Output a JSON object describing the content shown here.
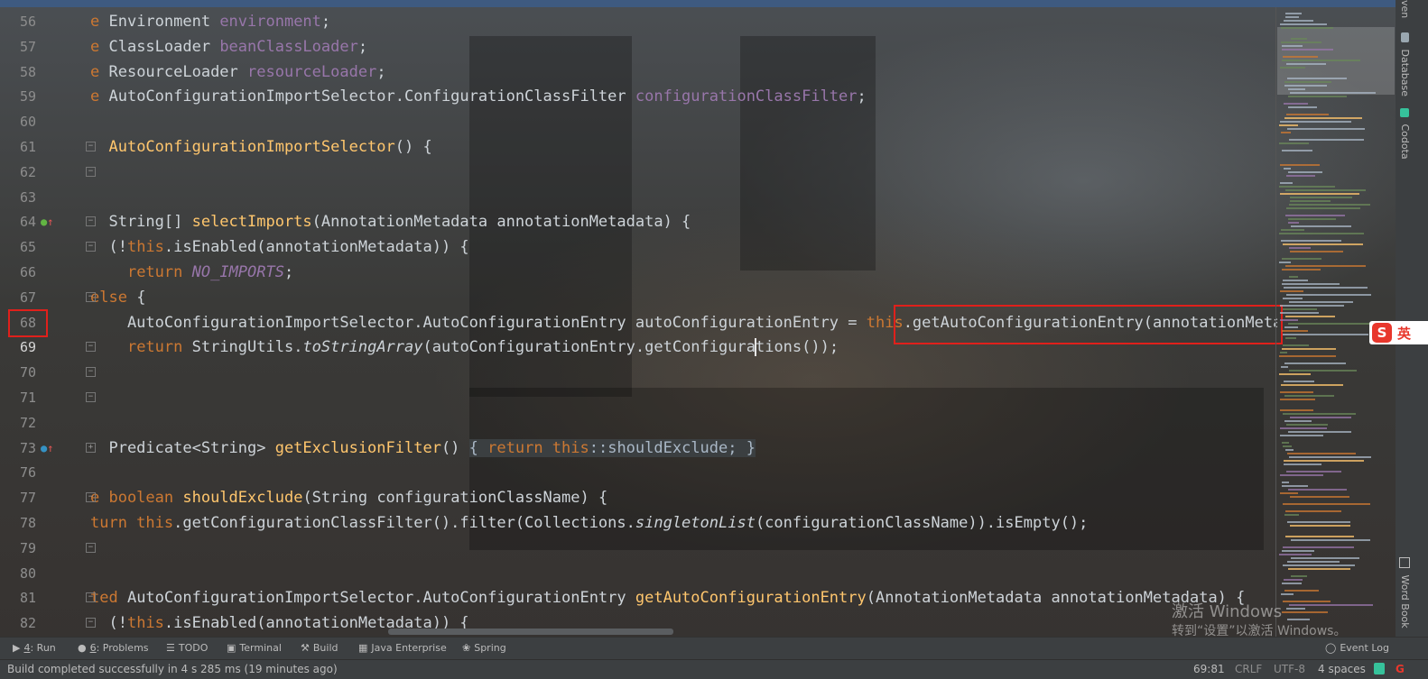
{
  "editor": {
    "lines": [
      {
        "num": "56",
        "html": "<span class=\"kw\">e</span> Environment <span class=\"fld\">environment</span>;"
      },
      {
        "num": "57",
        "html": "<span class=\"kw\">e</span> ClassLoader <span class=\"fld\">beanClassLoader</span>;"
      },
      {
        "num": "58",
        "html": "<span class=\"kw\">e</span> ResourceLoader <span class=\"fld\">resourceLoader</span>;"
      },
      {
        "num": "59",
        "html": "<span class=\"kw\">e</span> AutoConfigurationImportSelector.ConfigurationClassFilter <span class=\"fld\">configurationClassFilter</span>;"
      },
      {
        "num": "60",
        "html": ""
      },
      {
        "num": "61",
        "html": "  <span class=\"fn\">AutoConfigurationImportSelector</span>() {"
      },
      {
        "num": "62",
        "html": ""
      },
      {
        "num": "63",
        "html": ""
      },
      {
        "num": "64",
        "html": "  String[] <span class=\"fn\">selectImports</span>(AnnotationMetadata annotationMetadata) {"
      },
      {
        "num": "65",
        "html": "  (!<span class=\"kw\">this</span>.isEnabled(annotationMetadata)) {"
      },
      {
        "num": "66",
        "html": "    <span class=\"kw\">return</span> <span class=\"itf\">NO_IMPORTS</span>;"
      },
      {
        "num": "67",
        "html": "<span class=\"kw\">else</span> {"
      },
      {
        "num": "68",
        "html": "    AutoConfigurationImportSelector.AutoConfigurationEntry autoConfigurationEntry = <span class=\"kw\">this</span>.getAutoConfigurationEntry(annotationMetadata);"
      },
      {
        "num": "69",
        "html": "    <span class=\"kw\">return</span> StringUtils.<span class=\"it\">toStringArray</span>(autoConfigurationEntry.getConfigura<span class=\"caret\"></span>tions());"
      },
      {
        "num": "70",
        "html": ""
      },
      {
        "num": "71",
        "html": ""
      },
      {
        "num": "72",
        "html": ""
      },
      {
        "num": "73",
        "html": "  Predicate&lt;String&gt; <span class=\"fn\">getExclusionFilter</span>() <span class=\"fold-chip\">{ <span class=\"kw\">return this</span>::shouldExclude; }</span>"
      },
      {
        "num": "76",
        "html": ""
      },
      {
        "num": "77",
        "html": "<span class=\"kw\">e boolean</span> <span class=\"fn\">shouldExclude</span>(String configurationClassName) {"
      },
      {
        "num": "78",
        "html": "<span class=\"kw\">turn this</span>.getConfigurationClassFilter().filter(Collections.<span class=\"it\">singletonList</span>(configurationClassName)).isEmpty();"
      },
      {
        "num": "79",
        "html": ""
      },
      {
        "num": "80",
        "html": ""
      },
      {
        "num": "81",
        "html": "<span class=\"kw\">ted</span> AutoConfigurationImportSelector.AutoConfigurationEntry <span class=\"fn\">getAutoConfigurationEntry</span>(AnnotationMetadata annotationMetadata) {"
      },
      {
        "num": "82",
        "html": "  (!<span class=\"kw\">this</span>.isEnabled(annotationMetadata)) {"
      }
    ],
    "current_line": "69"
  },
  "right_panel": {
    "tabs": [
      "Database",
      "Codota",
      "Word Book"
    ],
    "top_tab_fragment": "ven"
  },
  "ime": {
    "char": "英",
    "logo": "S"
  },
  "watermark": {
    "line1": "激活 Windows",
    "line2": "转到“设置”以激活 Windows。"
  },
  "toolbar": {
    "items": [
      {
        "key": "run",
        "icon": "▶",
        "label": "4: Run",
        "underline": "4"
      },
      {
        "key": "problems",
        "icon": "●",
        "label": "6: Problems",
        "underline": "6"
      },
      {
        "key": "todo",
        "icon": "☰",
        "label": "TODO"
      },
      {
        "key": "terminal",
        "icon": "▣",
        "label": "Terminal"
      },
      {
        "key": "build",
        "icon": "⚒",
        "label": "Build"
      },
      {
        "key": "java-enterprise",
        "icon": "▦",
        "label": "Java Enterprise"
      },
      {
        "key": "spring",
        "icon": "❀",
        "label": "Spring"
      }
    ],
    "event_log": "Event Log"
  },
  "status": {
    "message": "Build completed successfully in 4 s 285 ms (19 minutes ago)",
    "position": "69:81",
    "line_sep": "CRLF",
    "encoding": "UTF-8",
    "indent": "4 spaces"
  },
  "colors": {
    "keyword": "#cc7832",
    "field": "#9876aa",
    "method": "#ffc66d",
    "highlight_box": "#e0201b",
    "status_bg": "#3c3f41"
  }
}
